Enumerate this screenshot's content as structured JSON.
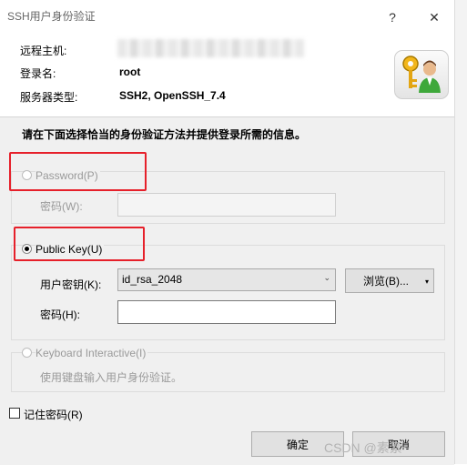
{
  "window": {
    "title": "SSH用户身份验证",
    "help_label": "?",
    "close_label": "✕"
  },
  "info": {
    "remote_host_label": "远程主机:",
    "login_name_label": "登录名:",
    "login_name_value": "root",
    "server_type_label": "服务器类型:",
    "server_type_value": "SSH2, OpenSSH_7.4"
  },
  "instruction": "请在下面选择恰当的身份验证方法并提供登录所需的信息。",
  "password_group": {
    "radio_label": "Password(P)",
    "field_label": "密码(W):",
    "field_value": ""
  },
  "pubkey_group": {
    "radio_label": "Public Key(U)",
    "user_key_label": "用户密钥(K):",
    "user_key_value": "id_rsa_2048",
    "browse_label": "浏览(B)...",
    "passphrase_label": "密码(H):",
    "passphrase_value": ""
  },
  "keyboard_group": {
    "radio_label": "Keyboard Interactive(I)",
    "description": "使用键盘输入用户身份验证。"
  },
  "remember": {
    "label": "记住密码(R)"
  },
  "buttons": {
    "ok": "确定",
    "cancel": "取消"
  },
  "watermark": "CSDN @素素~",
  "colors": {
    "highlight": "#e6202a",
    "dialog_bg": "#f0f0f0"
  }
}
